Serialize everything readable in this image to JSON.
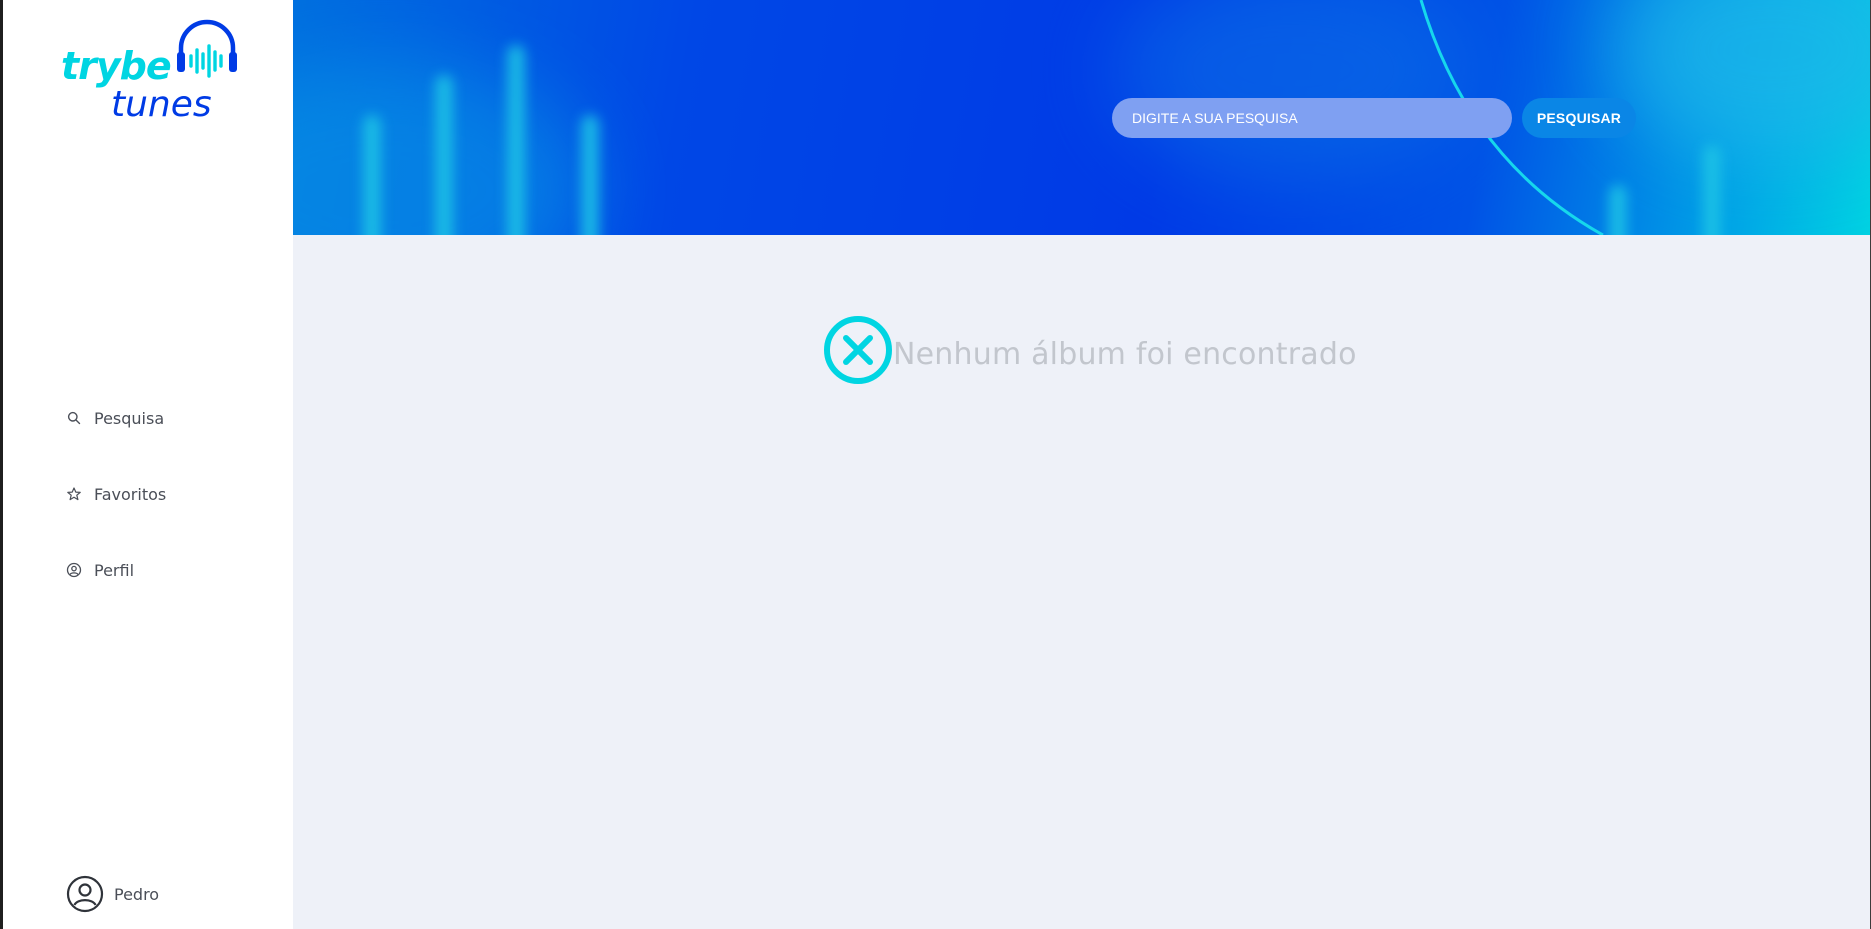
{
  "brand": {
    "word1": "trybe",
    "word2": "tunes",
    "logo_icon": "headphones-waveform-icon",
    "colors": {
      "cyan": "#00d5e2",
      "blue": "#003be5"
    }
  },
  "sidebar": {
    "items": [
      {
        "label": "Pesquisa",
        "icon": "search-icon"
      },
      {
        "label": "Favoritos",
        "icon": "star-icon"
      },
      {
        "label": "Perfil",
        "icon": "user-circle-icon"
      }
    ],
    "user": {
      "name": "Pedro",
      "icon": "avatar-icon"
    }
  },
  "header": {
    "search_placeholder": "DIGITE A SUA PESQUISA",
    "search_button": "PESQUISAR"
  },
  "main": {
    "empty_message": "Nenhum álbum foi encontrado",
    "empty_icon": "close-circle-icon",
    "accent": "#00d5e2"
  }
}
